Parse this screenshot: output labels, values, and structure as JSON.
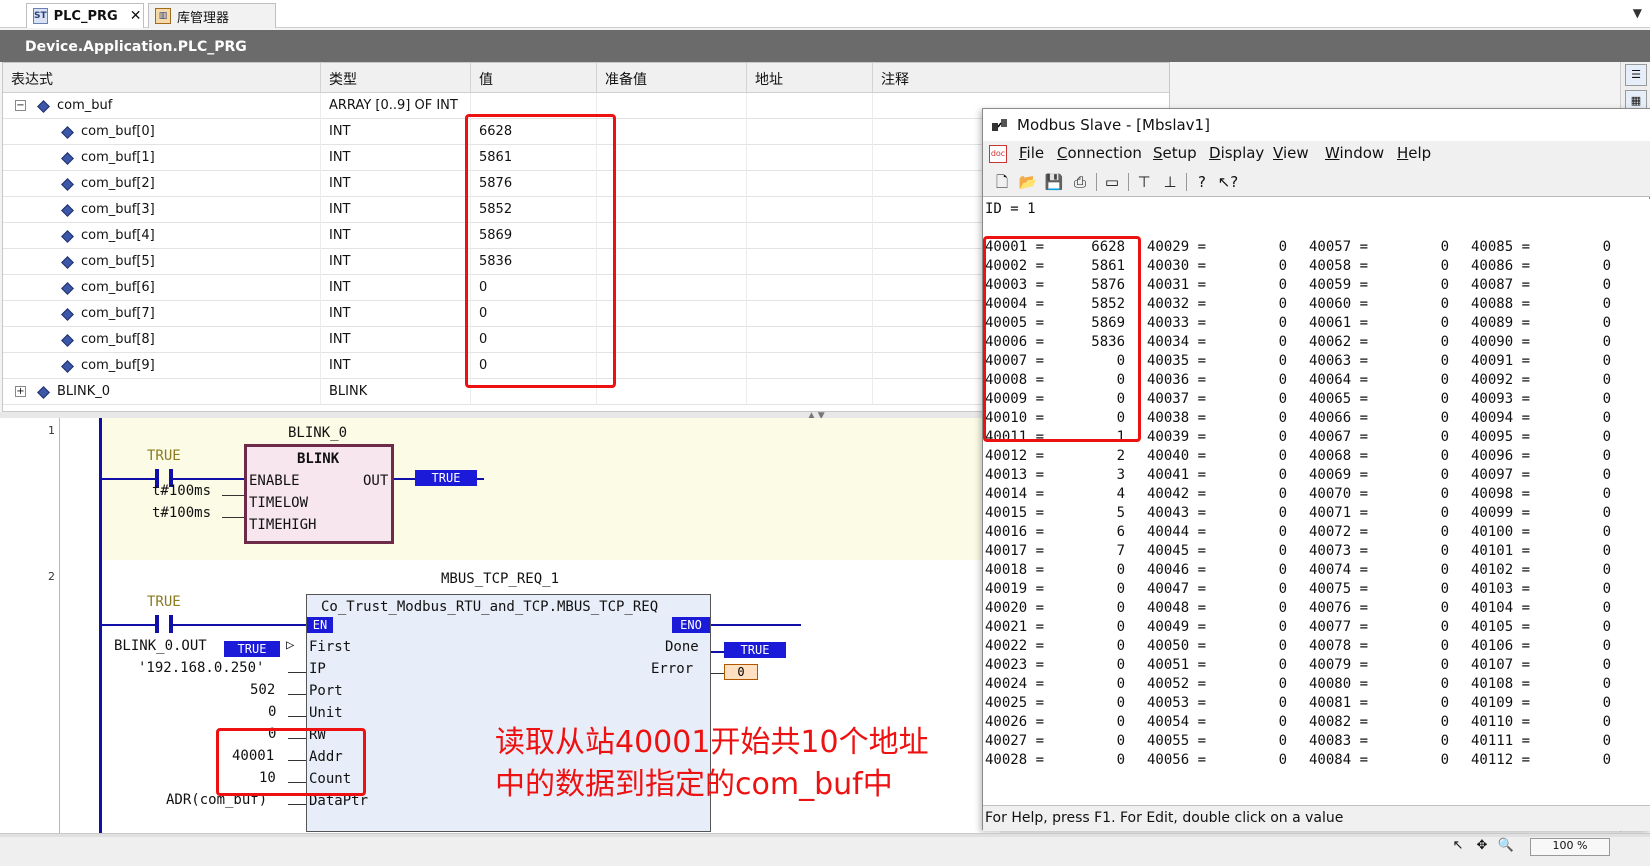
{
  "tabs": [
    {
      "label": "PLC_PRG",
      "icon": "plc-prg-icon",
      "close": "✕"
    },
    {
      "label": "库管理器",
      "icon": "library-icon"
    }
  ],
  "path": "Device.Application.PLC_PRG",
  "watch": {
    "headers": [
      "表达式",
      "类型",
      "值",
      "准备值",
      "地址",
      "注释"
    ],
    "rows": [
      {
        "expr": "com_buf",
        "type": "ARRAY [0..9] OF INT",
        "value": "",
        "toggle": "−"
      },
      {
        "expr": "com_buf[0]",
        "type": "INT",
        "value": "6628"
      },
      {
        "expr": "com_buf[1]",
        "type": "INT",
        "value": "5861"
      },
      {
        "expr": "com_buf[2]",
        "type": "INT",
        "value": "5876"
      },
      {
        "expr": "com_buf[3]",
        "type": "INT",
        "value": "5852"
      },
      {
        "expr": "com_buf[4]",
        "type": "INT",
        "value": "5869"
      },
      {
        "expr": "com_buf[5]",
        "type": "INT",
        "value": "5836"
      },
      {
        "expr": "com_buf[6]",
        "type": "INT",
        "value": "0"
      },
      {
        "expr": "com_buf[7]",
        "type": "INT",
        "value": "0"
      },
      {
        "expr": "com_buf[8]",
        "type": "INT",
        "value": "0"
      },
      {
        "expr": "com_buf[9]",
        "type": "INT",
        "value": "0"
      },
      {
        "expr": "BLINK_0",
        "type": "BLINK",
        "value": "",
        "toggle": "+"
      }
    ]
  },
  "ladder": {
    "net1": {
      "number": "1",
      "instance": "BLINK_0",
      "block_type": "BLINK",
      "contact_value": "TRUE",
      "inputs": [
        {
          "pin": "ENABLE",
          "var": ""
        },
        {
          "pin": "TIMELOW",
          "var": "t#100ms"
        },
        {
          "pin": "TIMEHIGH",
          "var": "t#100ms"
        }
      ],
      "output_pin": "OUT",
      "output_value": "TRUE"
    },
    "net2": {
      "number": "2",
      "instance": "MBUS_TCP_REQ_1",
      "block_type": "Co_Trust_Modbus_RTU_and_TCP.MBUS_TCP_REQ",
      "contact_value": "TRUE",
      "en": "EN",
      "eno": "ENO",
      "inputs": [
        {
          "pin": "First",
          "var": "BLINK_0.OUT",
          "tag": "TRUE"
        },
        {
          "pin": "IP",
          "var": "'192.168.0.250'"
        },
        {
          "pin": "Port",
          "var": "502"
        },
        {
          "pin": "Unit",
          "var": "0"
        },
        {
          "pin": "RW",
          "var": "0"
        },
        {
          "pin": "Addr",
          "var": "40001"
        },
        {
          "pin": "Count",
          "var": "10"
        },
        {
          "pin": "DataPtr",
          "var": "ADR(com_buf)"
        }
      ],
      "outputs": [
        {
          "pin": "Done",
          "value": "TRUE"
        },
        {
          "pin": "Error",
          "value": "0"
        }
      ]
    }
  },
  "annotation": {
    "line1": "读取从站40001开始共10个地址",
    "line2": "中的数据到指定的com_buf中"
  },
  "modbus": {
    "title": "Modbus Slave - [Mbslav1]",
    "menu": [
      "File",
      "Connection",
      "Setup",
      "Display",
      "View",
      "Window",
      "Help"
    ],
    "menu_hotkeys": [
      "F",
      "C",
      "S",
      "D",
      "V",
      "W",
      "H"
    ],
    "id_line": "ID = 1",
    "columns": [
      {
        "start": 40001,
        "values": [
          "6628",
          "5861",
          "5876",
          "5852",
          "5869",
          "5836",
          "0",
          "0",
          "0",
          "0",
          "1",
          "2",
          "3",
          "4",
          "5",
          "6",
          "7",
          "0",
          "0",
          "0",
          "0",
          "0",
          "0",
          "0",
          "0",
          "0",
          "0",
          "0"
        ]
      },
      {
        "start": 40029,
        "values": [
          "0",
          "0",
          "0",
          "0",
          "0",
          "0",
          "0",
          "0",
          "0",
          "0",
          "0",
          "0",
          "0",
          "0",
          "0",
          "0",
          "0",
          "0",
          "0",
          "0",
          "0",
          "0",
          "0",
          "0",
          "0",
          "0",
          "0",
          "0"
        ]
      },
      {
        "start": 40057,
        "values": [
          "0",
          "0",
          "0",
          "0",
          "0",
          "0",
          "0",
          "0",
          "0",
          "0",
          "0",
          "0",
          "0",
          "0",
          "0",
          "0",
          "0",
          "0",
          "0",
          "0",
          "0",
          "0",
          "0",
          "0",
          "0",
          "0",
          "0",
          "0"
        ]
      },
      {
        "start": 40085,
        "values": [
          "0",
          "0",
          "0",
          "0",
          "0",
          "0",
          "0",
          "0",
          "0",
          "0",
          "0",
          "0",
          "0",
          "0",
          "0",
          "0",
          "0",
          "0",
          "0",
          "0",
          "0",
          "0",
          "0",
          "0",
          "0",
          "0",
          "0",
          "0"
        ]
      }
    ],
    "status": "For Help, press F1.   For Edit, double click on a value"
  },
  "zoom": "100 %",
  "colors": {
    "rail": "#1010a8",
    "highlight": "#ee1111",
    "bool_tag": "#1a1ad8"
  }
}
